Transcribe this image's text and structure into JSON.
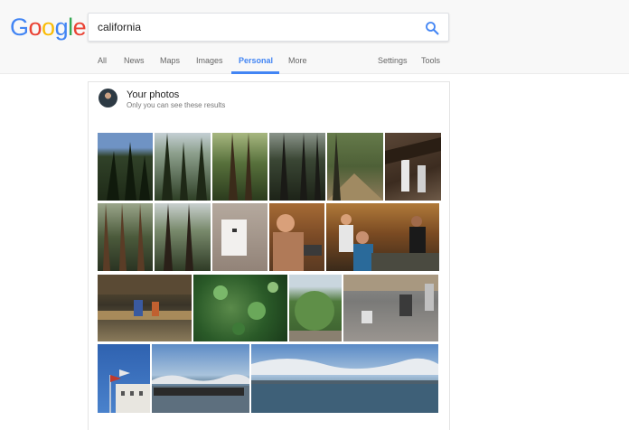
{
  "logo": {
    "letters": [
      {
        "char": "G",
        "color": "#4285f4"
      },
      {
        "char": "o",
        "color": "#ea4335"
      },
      {
        "char": "o",
        "color": "#fbbc05"
      },
      {
        "char": "g",
        "color": "#4285f4"
      },
      {
        "char": "l",
        "color": "#34a853"
      },
      {
        "char": "e",
        "color": "#ea4335"
      }
    ]
  },
  "search": {
    "query": "california",
    "icon": "search-icon",
    "icon_color": "#4285f4"
  },
  "nav": {
    "tabs": [
      {
        "label": "All",
        "active": false
      },
      {
        "label": "News",
        "active": false
      },
      {
        "label": "Maps",
        "active": false
      },
      {
        "label": "Images",
        "active": false
      },
      {
        "label": "Personal",
        "active": true
      },
      {
        "label": "More",
        "active": false
      }
    ],
    "tools": [
      {
        "label": "Settings"
      },
      {
        "label": "Tools"
      }
    ],
    "accent_color": "#4285f4"
  },
  "card": {
    "title": "Your photos",
    "subtitle": "Only you can see these results",
    "avatar": "user-avatar"
  },
  "photos": [
    {
      "subject": "redwood forest canopy looking up"
    },
    {
      "subject": "redwood trees"
    },
    {
      "subject": "sunlit redwood trunks"
    },
    {
      "subject": "dark redwood forest"
    },
    {
      "subject": "forest trail"
    },
    {
      "subject": "people climbing fallen redwood"
    },
    {
      "subject": "tall redwood trunks"
    },
    {
      "subject": "redwood grove"
    },
    {
      "subject": "white device on wall"
    },
    {
      "subject": "man with glasses at workbench"
    },
    {
      "subject": "people in workshop"
    },
    {
      "subject": "glass display with objects"
    },
    {
      "subject": "tree leaves"
    },
    {
      "subject": "green shrub"
    },
    {
      "subject": "patio with tables and chairs"
    },
    {
      "subject": "flags on building"
    },
    {
      "subject": "ship on bay"
    },
    {
      "subject": "bay panorama with clouds"
    }
  ]
}
